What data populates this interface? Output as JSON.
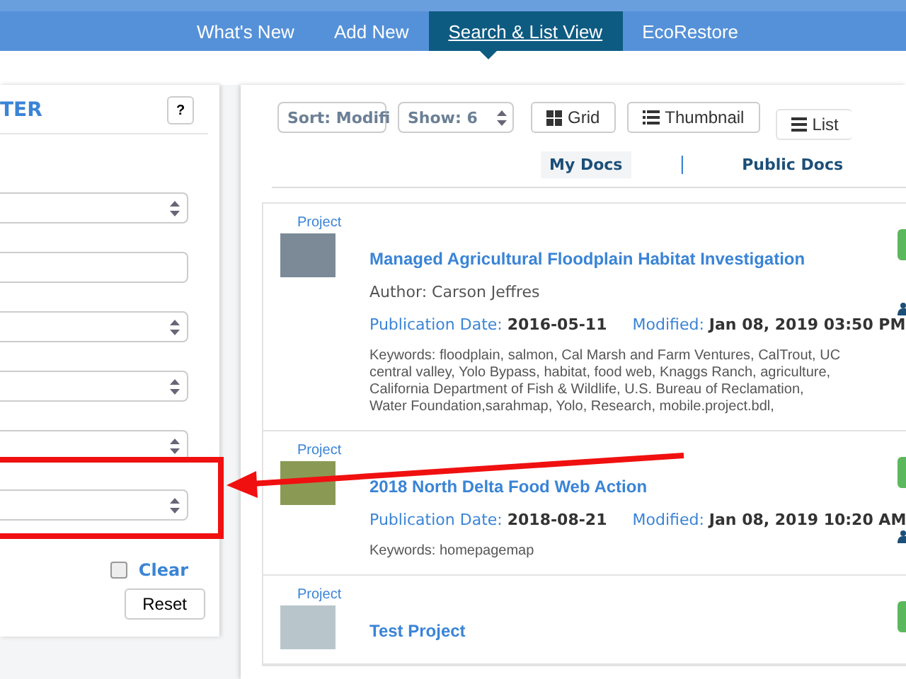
{
  "nav": {
    "tabs": [
      {
        "label": "What's New",
        "selected": false
      },
      {
        "label": "Add New",
        "selected": false
      },
      {
        "label": "Search & List View",
        "selected": true
      },
      {
        "label": "EcoRestore",
        "selected": false
      }
    ]
  },
  "filter": {
    "title": "TER",
    "help": "?",
    "fields": [
      {
        "kind": "select"
      },
      {
        "kind": "text"
      },
      {
        "kind": "select"
      },
      {
        "kind": "select"
      },
      {
        "kind": "select"
      },
      {
        "kind": "select"
      }
    ],
    "clear": {
      "label": "Clear",
      "checked": false
    },
    "reset": "Reset"
  },
  "toolbar": {
    "sort": "Sort: Modifi",
    "show": "Show: 6",
    "views": [
      {
        "kind": "grid",
        "label": "Grid"
      },
      {
        "kind": "thumbnail",
        "label": "Thumbnail"
      },
      {
        "kind": "list",
        "label": "List"
      }
    ]
  },
  "doc_tabs": {
    "items": [
      {
        "label": "My Docs",
        "selected": true
      },
      {
        "label": "Public Docs",
        "selected": false
      }
    ],
    "separator": "|"
  },
  "results": [
    {
      "type": "Project",
      "title": "Managed Agricultural Floodplain Habitat Investigation",
      "author": "Author: Carson Jeffres",
      "pub_label": "Publication Date:",
      "pub_date": "2016-05-11",
      "mod_label": "Modified:",
      "modified": "Jan 08, 2019 03:50 PM",
      "keywords": [
        "Keywords: floodplain, salmon, Cal Marsh and Farm Ventures, CalTrout, UC",
        "central valley, Yolo Bypass, habitat, food web, Knaggs Ranch, agriculture,",
        "California Department of Fish & Wildlife, U.S. Bureau of Reclamation,",
        "Water Foundation,sarahmap, Yolo, Research, mobile.project.bdl,"
      ]
    },
    {
      "type": "Project",
      "title": "2018 North Delta Food Web Action",
      "pub_label": "Publication Date:",
      "pub_date": "2018-08-21",
      "mod_label": "Modified:",
      "modified": "Jan 08, 2019 10:20 AM",
      "keywords": [
        "Keywords: homepagemap"
      ]
    },
    {
      "type": "Project",
      "title": "Test Project"
    }
  ]
}
